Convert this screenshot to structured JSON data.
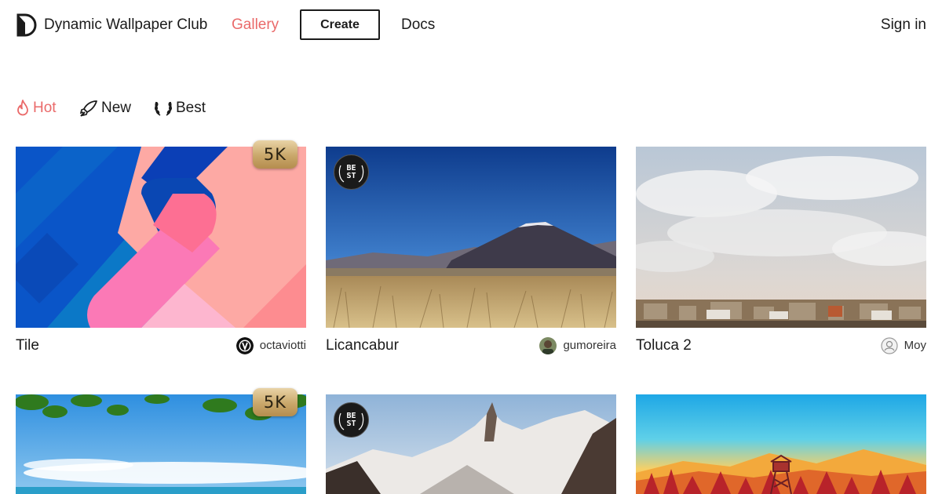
{
  "header": {
    "brand": "Dynamic Wallpaper Club",
    "nav": {
      "gallery": "Gallery",
      "create": "Create",
      "docs": "Docs",
      "sign_in": "Sign in"
    }
  },
  "filters": [
    {
      "label": "Hot",
      "icon": "flame-icon",
      "active": true
    },
    {
      "label": "New",
      "icon": "rocket-icon",
      "active": false
    },
    {
      "label": "Best",
      "icon": "laurel-icon",
      "active": false
    }
  ],
  "cards": [
    {
      "title": "Tile",
      "author": "octaviotti",
      "badge": "5K"
    },
    {
      "title": "Licancabur",
      "author": "gumoreira",
      "badge": "BEST"
    },
    {
      "title": "Toluca 2",
      "author": "Moy",
      "badge": ""
    },
    {
      "title": "",
      "author": "",
      "badge": "5K"
    },
    {
      "title": "",
      "author": "",
      "badge": "BEST"
    },
    {
      "title": "",
      "author": "",
      "badge": ""
    }
  ],
  "badges": {
    "five_k": "5K",
    "best_line1": "BE",
    "best_line2": "ST"
  },
  "colors": {
    "accent": "#ea6a6a",
    "text": "#1b1b1b"
  }
}
